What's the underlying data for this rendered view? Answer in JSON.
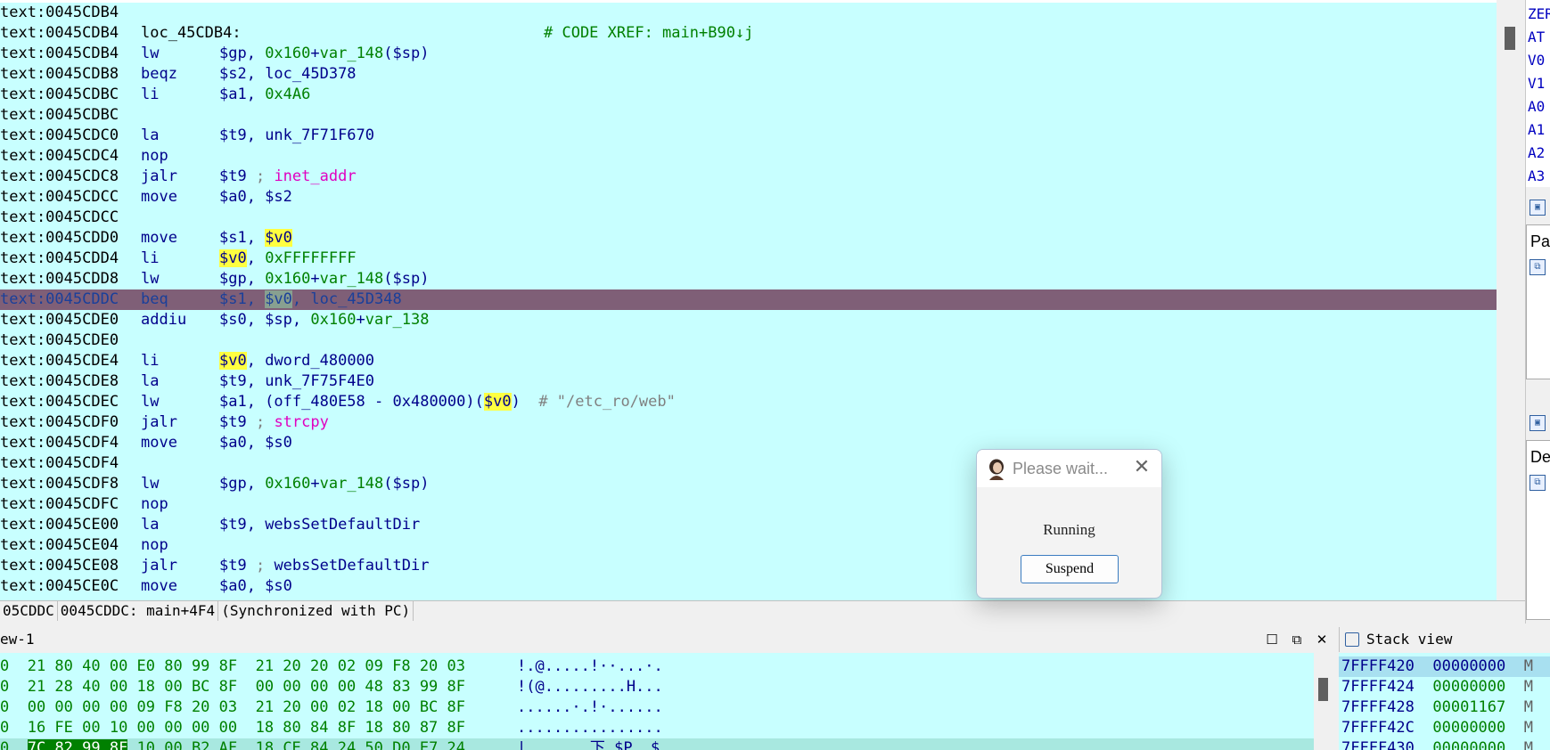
{
  "disasm": {
    "lines": [
      {
        "addr": "text:0045CDB4",
        "label": "",
        "mn": "",
        "ops": ""
      },
      {
        "addr": "text:0045CDB4",
        "label": "loc_45CDB4:",
        "xref": "# CODE XREF: main+B90↓j"
      },
      {
        "addr": "text:0045CDB4",
        "mn": "lw"
      },
      {
        "addr": "text:0045CDB8",
        "mn": "beqz"
      },
      {
        "addr": "text:0045CDBC",
        "mn": "li"
      },
      {
        "addr": "text:0045CDBC"
      },
      {
        "addr": "text:0045CDC0",
        "mn": "la"
      },
      {
        "addr": "text:0045CDC4",
        "mn": "nop"
      },
      {
        "addr": "text:0045CDC8",
        "mn": "jalr"
      },
      {
        "addr": "text:0045CDCC",
        "mn": "move"
      },
      {
        "addr": "text:0045CDCC"
      },
      {
        "addr": "text:0045CDD0",
        "mn": "move"
      },
      {
        "addr": "text:0045CDD4",
        "mn": "li"
      },
      {
        "addr": "text:0045CDD8",
        "mn": "lw"
      },
      {
        "addr": "text:0045CDDC",
        "mn": "beq"
      },
      {
        "addr": "text:0045CDE0",
        "mn": "addiu"
      },
      {
        "addr": "text:0045CDE0"
      },
      {
        "addr": "text:0045CDE4",
        "mn": "li"
      },
      {
        "addr": "text:0045CDE8",
        "mn": "la"
      },
      {
        "addr": "text:0045CDEC",
        "mn": "lw"
      },
      {
        "addr": "text:0045CDF0",
        "mn": "jalr"
      },
      {
        "addr": "text:0045CDF4",
        "mn": "move"
      },
      {
        "addr": "text:0045CDF4"
      },
      {
        "addr": "text:0045CDF8",
        "mn": "lw"
      },
      {
        "addr": "text:0045CDFC",
        "mn": "nop"
      },
      {
        "addr": "text:0045CE00",
        "mn": "la"
      },
      {
        "addr": "text:0045CE04",
        "mn": "nop"
      },
      {
        "addr": "text:0045CE08",
        "mn": "jalr"
      },
      {
        "addr": "text:0045CE0C",
        "mn": "move"
      }
    ],
    "ops": {
      "l2a": "$gp, ",
      "l2b": "0x160",
      "l2c": "+",
      "l2d": "var_148",
      "l2e": "($sp)",
      "l3a": "$s2, ",
      "l3b": "loc_45D378",
      "l4a": "$a1, ",
      "l4b": "0x4A6",
      "l6a": "$t9, ",
      "l6b": "unk_7F71F670",
      "l8a": "$t9 ",
      "l8b": "; ",
      "l8c": "inet_addr",
      "l9a": "$a0, $s2",
      "l11a": "$s1, ",
      "l11b": "$v0",
      "l12a": "$v0",
      "l12b": ", ",
      "l12c": "0xFFFFFFFF",
      "l13a": "$gp, ",
      "l13b": "0x160",
      "l13c": "+",
      "l13d": "var_148",
      "l13e": "($sp)",
      "l14a": "$s1, ",
      "l14b": "$v0",
      "l14c": ", loc_45D348",
      "l15a": "$s0, $sp, ",
      "l15b": "0x160",
      "l15c": "+",
      "l15d": "var_138",
      "l17a": "$v0",
      "l17b": ", ",
      "l17c": "dword_480000",
      "l18a": "$t9, ",
      "l18b": "unk_7F75F4E0",
      "l19a": "$a1, (",
      "l19b": "off_480E58",
      "l19c": " - ",
      "l19d": "0x480000",
      ")": ")",
      "l19e": "$v0",
      "l19f": ")  ",
      "l19g": "# \"/etc_ro/web\"",
      "l20a": "$t9 ",
      "l20b": "; ",
      "l20c": "strcpy",
      "l21a": "$a0, $s0",
      "l23a": "$gp, ",
      "l23b": "0x160",
      "l23c": "+",
      "l23d": "var_148",
      "l23e": "($sp)",
      "l25a": "$t9, ",
      "l25b": "websSetDefaultDir",
      "l27a": "$t9 ",
      "l27b": "; ",
      "l27c": "websSetDefaultDir",
      "l28a": "$a0, $s0",
      "paren_open": "(",
      "paren_close": ")"
    }
  },
  "registers": [
    "ZER",
    "AT",
    "V0",
    "V1",
    "A0",
    "A1",
    "A2",
    "A3"
  ],
  "right_panels": {
    "pa": "Pa",
    "de": "De"
  },
  "status": {
    "seg1": "05CDDC",
    "seg2": "0045CDDC: main+4F4",
    "seg3": "(Synchronized with PC)"
  },
  "hex_view": {
    "title": "ew-1",
    "rows": [
      {
        "pre": "0",
        "bytes": "  21 80 40 00 E0 80 99 8F  21 20 20 02 09 F8 20 03",
        "ascii": "!.@.....!··...·."
      },
      {
        "pre": "0",
        "bytes": "  21 28 40 00 18 00 BC 8F  00 00 00 00 48 83 99 8F",
        "ascii": "!(@.........H..."
      },
      {
        "pre": "0",
        "bytes": "  00 00 00 00 09 F8 20 03  21 20 00 02 18 00 BC 8F",
        "ascii": "......·.!·......"
      },
      {
        "pre": "0",
        "bytes": "  16 FE 00 10 00 00 00 00  18 80 84 8F 18 80 87 8F",
        "ascii": "................"
      },
      {
        "pre": "0",
        "sel": "7C 82 99 8F",
        "bytes": " 10 00 B2 AF  18 CE 84 24 50 D0 E7 24",
        "ascii": "|.......下.$P..$"
      }
    ]
  },
  "stack_view": {
    "title": "Stack view",
    "rows": [
      {
        "addr": "7FFFF420",
        "val": "00000000",
        "m": "M"
      },
      {
        "addr": "7FFFF424",
        "val": "00000000",
        "m": "M"
      },
      {
        "addr": "7FFFF428",
        "val": "00001167",
        "m": "M"
      },
      {
        "addr": "7FFFF42C",
        "val": "00000000",
        "m": "M"
      },
      {
        "addr": "7FFFF430",
        "val": "00000000",
        "m": "M"
      }
    ]
  },
  "dialog": {
    "title": "Please wait...",
    "message": "Running",
    "button": "Suspend"
  }
}
